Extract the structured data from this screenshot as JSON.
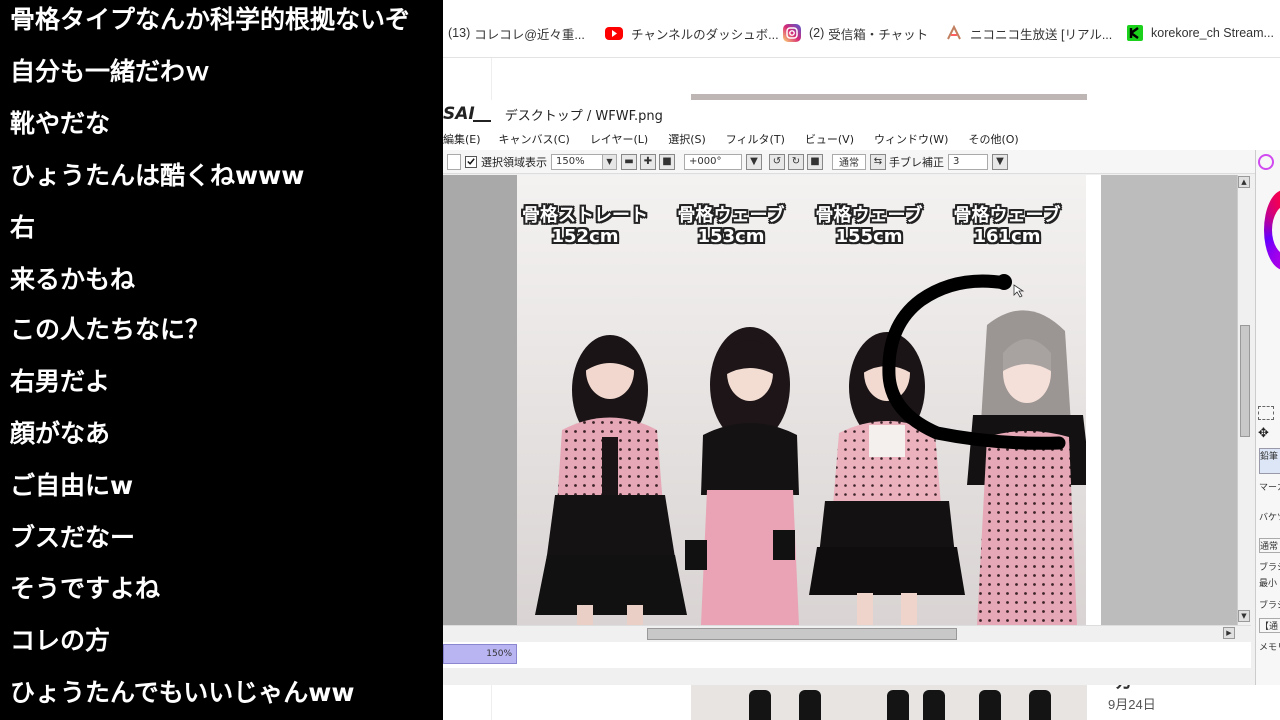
{
  "comments": [
    "骨格タイプなんか科学的根拠ないぞ",
    "自分も一緒だわｗ",
    "靴やだな",
    "ひょうたんは酷くねwww",
    "右",
    "来るかもね",
    "この人たちなに？",
    "右男だよ",
    "顔がなあ",
    "ご自由にw",
    "ブスだなー",
    "そうですよね",
    "コレの方",
    "ひょうたんでもいいじゃんww"
  ],
  "bookmarks": [
    {
      "count": "(13)",
      "label": "コレコレ@近々重...",
      "icon": "globe-icon",
      "color": "#888888"
    },
    {
      "count": "",
      "label": "チャンネルのダッシュボ...",
      "icon": "youtube-icon",
      "color": "#ff0000"
    },
    {
      "count": "(2)",
      "label": "受信箱・チャット",
      "icon": "instagram-icon",
      "color": "#d6249f"
    },
    {
      "count": "",
      "label": "ニコニコ生放送 [リアル...",
      "icon": "niconico-icon",
      "color": "#c9a080"
    },
    {
      "count": "",
      "label": "korekore_ch Stream...",
      "icon": "kick-icon",
      "color": "#1bd11b"
    }
  ],
  "sai": {
    "logo": "SAI",
    "doc_path": "デスクトップ / WFWF.png",
    "menu": [
      "編集(E)",
      "キャンバス(C)",
      "レイヤー(L)",
      "選択(S)",
      "フィルタ(T)",
      "ビュー(V)",
      "ウィンドウ(W)",
      "その他(O)"
    ],
    "toolbar": {
      "selection_display_label": "選択領域表示",
      "zoom_value": "150%",
      "angle_value": "+000°",
      "blend_mode": "通常",
      "stabilizer_label": "手ブレ補正",
      "stabilizer_value": "3"
    },
    "zoom_chip": "150%",
    "side_panel": [
      "鉛筆",
      "マーカ",
      "バケツ",
      "通常",
      "ブラシ",
      "最小",
      "ブラシ",
      "【通",
      "メモリ使"
    ]
  },
  "canvas_captions": [
    {
      "type": "骨格ストレート",
      "height": "152cm"
    },
    {
      "type": "骨格ウェーブ",
      "height": "153cm"
    },
    {
      "type": "骨格ウェーブ",
      "height": "155cm"
    },
    {
      "type": "骨格ウェーブ",
      "height": "161cm"
    }
  ],
  "page": {
    "date": "9月24日",
    "fragment": "ガ"
  },
  "colors": {
    "comment_text": "#ffffff",
    "drawing_stroke": "#000000",
    "zoom_chip": "#b9b4f2",
    "dress_pink": "#e7a9b8"
  }
}
